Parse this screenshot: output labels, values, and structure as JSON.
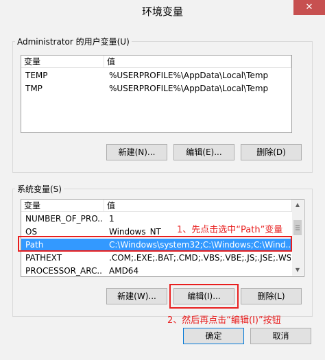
{
  "window": {
    "title": "环境变量",
    "close_glyph": "✕"
  },
  "user_vars": {
    "group_label": "Administrator 的用户变量(U)",
    "columns": [
      "变量",
      "值"
    ],
    "rows": [
      {
        "name": "TEMP",
        "value": "%USERPROFILE%\\AppData\\Local\\Temp"
      },
      {
        "name": "TMP",
        "value": "%USERPROFILE%\\AppData\\Local\\Temp"
      }
    ],
    "buttons": {
      "new": "新建(N)...",
      "edit": "编辑(E)...",
      "delete": "删除(D)"
    }
  },
  "system_vars": {
    "group_label": "系统变量(S)",
    "columns": [
      "变量",
      "值"
    ],
    "rows": [
      {
        "name": "NUMBER_OF_PRO...",
        "value": "1"
      },
      {
        "name": "OS",
        "value": "Windows_NT"
      },
      {
        "name": "Path",
        "value": "C:\\Windows\\system32;C:\\Windows;C:\\Wind..."
      },
      {
        "name": "PATHEXT",
        "value": ".COM;.EXE;.BAT;.CMD;.VBS;.VBE;.JS;.JSE;.WSF;..."
      },
      {
        "name": "PROCESSOR_ARC...",
        "value": "AMD64"
      }
    ],
    "selected_row": "Path",
    "buttons": {
      "new": "新建(W)...",
      "edit": "编辑(I)...",
      "delete": "删除(L)"
    }
  },
  "footer": {
    "ok": "确定",
    "cancel": "取消"
  },
  "annotations": {
    "step1": "1、先点击选中“Path”变量",
    "step2": "2、然后再点击“编辑(I)”按钮"
  },
  "colors": {
    "selection": "#3399ff",
    "annotation": "#e81e1e",
    "close_button": "#c75050"
  },
  "icons": [
    "close-icon",
    "scroll-up-arrow-icon",
    "scroll-down-arrow-icon",
    "scroll-thumb-grip-icon"
  ]
}
